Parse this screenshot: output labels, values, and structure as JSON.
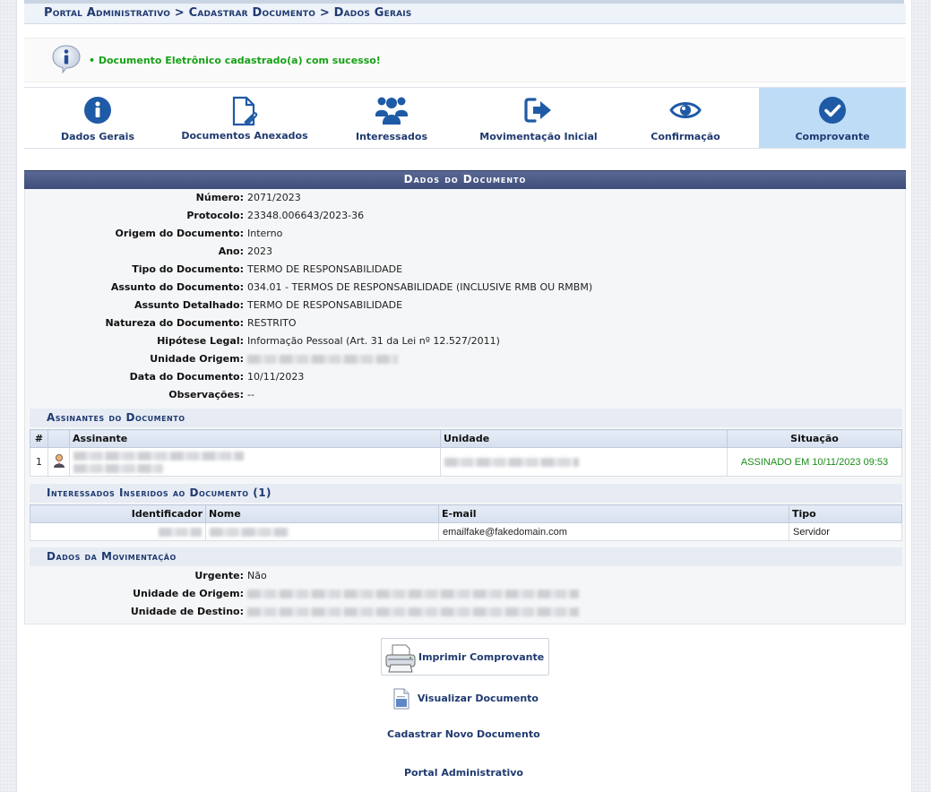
{
  "breadcrumb": "Portal Administrativo > Cadastrar Documento > Dados Gerais",
  "message": "• Documento Eletrônico cadastrado(a) com sucesso!",
  "wizard": {
    "steps": [
      {
        "label": "Dados Gerais",
        "icon": "info-circle-icon"
      },
      {
        "label": "Documentos Anexados",
        "icon": "document-attach-icon"
      },
      {
        "label": "Interessados",
        "icon": "users-icon"
      },
      {
        "label": "Movimentação Inicial",
        "icon": "sign-out-icon"
      },
      {
        "label": "Confirmação",
        "icon": "eye-icon"
      },
      {
        "label": "Comprovante",
        "icon": "check-circle-icon"
      }
    ],
    "active_index": 5
  },
  "section_title": "Dados do Documento",
  "document": {
    "numero": {
      "label": "Número:",
      "value": "2071/2023"
    },
    "protocolo": {
      "label": "Protocolo:",
      "value": "23348.006643/2023-36"
    },
    "origem": {
      "label": "Origem do Documento:",
      "value": "Interno"
    },
    "ano": {
      "label": "Ano:",
      "value": "2023"
    },
    "tipo": {
      "label": "Tipo do Documento:",
      "value": "TERMO DE RESPONSABILIDADE"
    },
    "assunto": {
      "label": "Assunto do Documento:",
      "value": "034.01 - TERMOS DE RESPONSABILIDADE (INCLUSIVE RMB OU RMBM)"
    },
    "assunto_detalhado": {
      "label": "Assunto Detalhado:",
      "value": "TERMO DE RESPONSABILIDADE"
    },
    "natureza": {
      "label": "Natureza do Documento:",
      "value": "RESTRITO"
    },
    "hipotese": {
      "label": "Hipótese Legal:",
      "value": "Informação Pessoal (Art. 31 da Lei nº 12.527/2011)"
    },
    "unidade_origem": {
      "label": "Unidade Origem:"
    },
    "data": {
      "label": "Data do Documento:",
      "value": "10/11/2023"
    },
    "observacoes": {
      "label": "Observações:",
      "value": "--"
    }
  },
  "assinantes": {
    "title": "Assinantes do Documento",
    "headers": {
      "num": "#",
      "assinante": "Assinante",
      "unidade": "Unidade",
      "situacao": "Situação"
    },
    "rows": [
      {
        "num": "1",
        "situacao": "ASSINADO EM 10/11/2023 09:53"
      }
    ]
  },
  "interessados": {
    "title": "Interessados Inseridos ao Documento (1)",
    "headers": {
      "identificador": "Identificador",
      "nome": "Nome",
      "email": "E-mail",
      "tipo": "Tipo"
    },
    "rows": [
      {
        "email": "emailfake@fakedomain.com",
        "tipo": "Servidor"
      }
    ]
  },
  "movimentacao": {
    "title": "Dados da Movimentação",
    "urgente": {
      "label": "Urgente:",
      "value": "Não"
    },
    "unidade_origem": {
      "label": "Unidade de Origem:"
    },
    "unidade_destino": {
      "label": "Unidade de Destino:"
    }
  },
  "actions": {
    "imprimir": "Imprimir Comprovante",
    "visualizar": "Visualizar Documento",
    "cadastrar_novo": "Cadastrar Novo Documento",
    "portal": "Portal Administrativo"
  },
  "colors": {
    "accent": "#1f3a70",
    "success": "#16a116",
    "header_bar": "#3e4d79",
    "active_step": "#bfdcf7"
  }
}
